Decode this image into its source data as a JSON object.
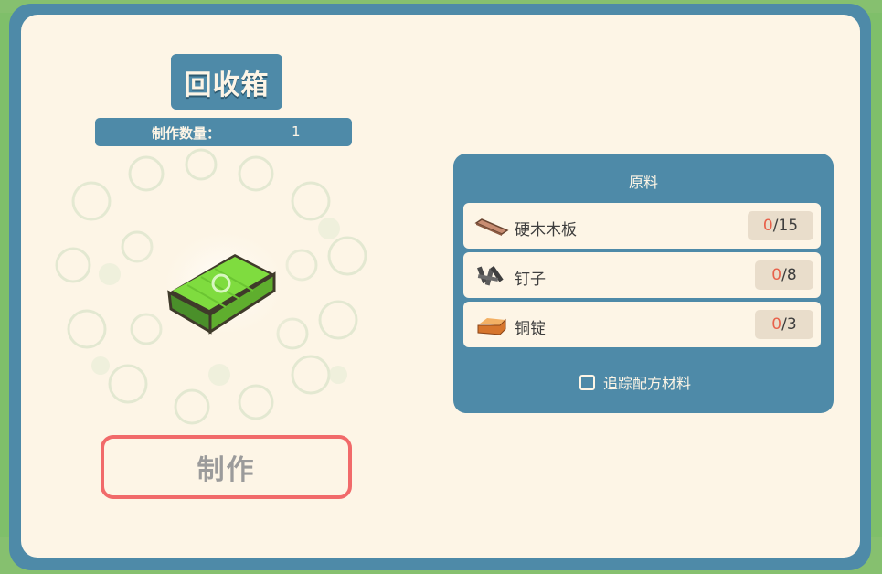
{
  "item": {
    "title": "回收箱",
    "quantity_label": "制作数量：",
    "quantity_value": "1",
    "icon": "green-recycle-chest"
  },
  "craft_button_label": "制作",
  "materials": {
    "header": "原料",
    "rows": [
      {
        "name": "硬木木板",
        "have": "0",
        "sep": " / ",
        "need": "15",
        "icon": "hardwood-plank-icon"
      },
      {
        "name": "钉子",
        "have": "0",
        "sep": " / ",
        "need": "8",
        "icon": "nails-icon"
      },
      {
        "name": "铜锭",
        "have": "0",
        "sep": " / ",
        "need": "3",
        "icon": "copper-ingot-icon"
      }
    ],
    "track_label": "追踪配方材料"
  },
  "colors": {
    "panel_blue": "#4e8aa8",
    "cream": "#fdf5e6",
    "craft_border": "#f16a6a",
    "missing_count": "#e8614b"
  }
}
